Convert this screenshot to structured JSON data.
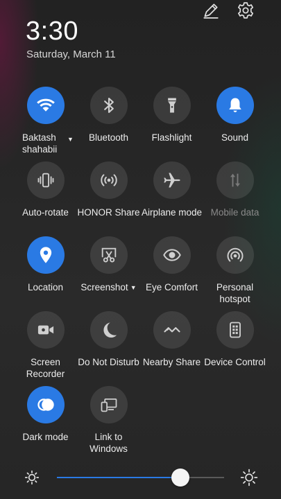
{
  "header": {
    "time": "3:30",
    "date": "Saturday, March 11"
  },
  "top_actions": [
    {
      "name": "edit-icon"
    },
    {
      "name": "gear-icon"
    }
  ],
  "tiles": [
    {
      "id": "wifi",
      "label": "Baktash shahabii",
      "active": true,
      "icon": "wifi-icon",
      "has_dropdown": true
    },
    {
      "id": "bluetooth",
      "label": "Bluetooth",
      "active": false,
      "icon": "bluetooth-icon"
    },
    {
      "id": "flashlight",
      "label": "Flashlight",
      "active": false,
      "icon": "flashlight-icon"
    },
    {
      "id": "sound",
      "label": "Sound",
      "active": true,
      "icon": "bell-icon"
    },
    {
      "id": "auto-rotate",
      "label": "Auto-rotate",
      "active": false,
      "icon": "rotate-icon"
    },
    {
      "id": "honor-share",
      "label": "HONOR Share",
      "active": false,
      "icon": "broadcast-icon"
    },
    {
      "id": "airplane",
      "label": "Airplane mode",
      "active": false,
      "icon": "airplane-icon"
    },
    {
      "id": "mobile-data",
      "label": "Mobile data",
      "active": false,
      "icon": "mobile-data-icon",
      "disabled": true
    },
    {
      "id": "location",
      "label": "Location",
      "active": true,
      "icon": "location-pin-icon"
    },
    {
      "id": "screenshot",
      "label": "Screenshot",
      "active": false,
      "icon": "scissors-icon",
      "has_dropdown": true
    },
    {
      "id": "eye-comfort",
      "label": "Eye Comfort",
      "active": false,
      "icon": "eye-icon"
    },
    {
      "id": "hotspot",
      "label": "Personal hotspot",
      "active": false,
      "icon": "hotspot-icon"
    },
    {
      "id": "screen-recorder",
      "label": "Screen Recorder",
      "active": false,
      "icon": "video-camera-icon"
    },
    {
      "id": "do-not-disturb",
      "label": "Do Not Disturb",
      "active": false,
      "icon": "moon-icon"
    },
    {
      "id": "nearby-share",
      "label": "Nearby Share",
      "active": false,
      "icon": "nearby-share-icon"
    },
    {
      "id": "device-control",
      "label": "Device Control",
      "active": false,
      "icon": "device-control-icon"
    },
    {
      "id": "dark-mode",
      "label": "Dark mode",
      "active": true,
      "icon": "dark-mode-icon"
    },
    {
      "id": "link-to-windows",
      "label": "Link to Windows",
      "active": false,
      "icon": "link-windows-icon"
    }
  ],
  "brightness": {
    "level_percent": 74,
    "low_icon": "brightness-low-icon",
    "high_icon": "brightness-high-icon",
    "accent": "#2a7ae4"
  },
  "colors": {
    "accent": "#2a7ae4",
    "tile_off": "#3a3a3a"
  }
}
